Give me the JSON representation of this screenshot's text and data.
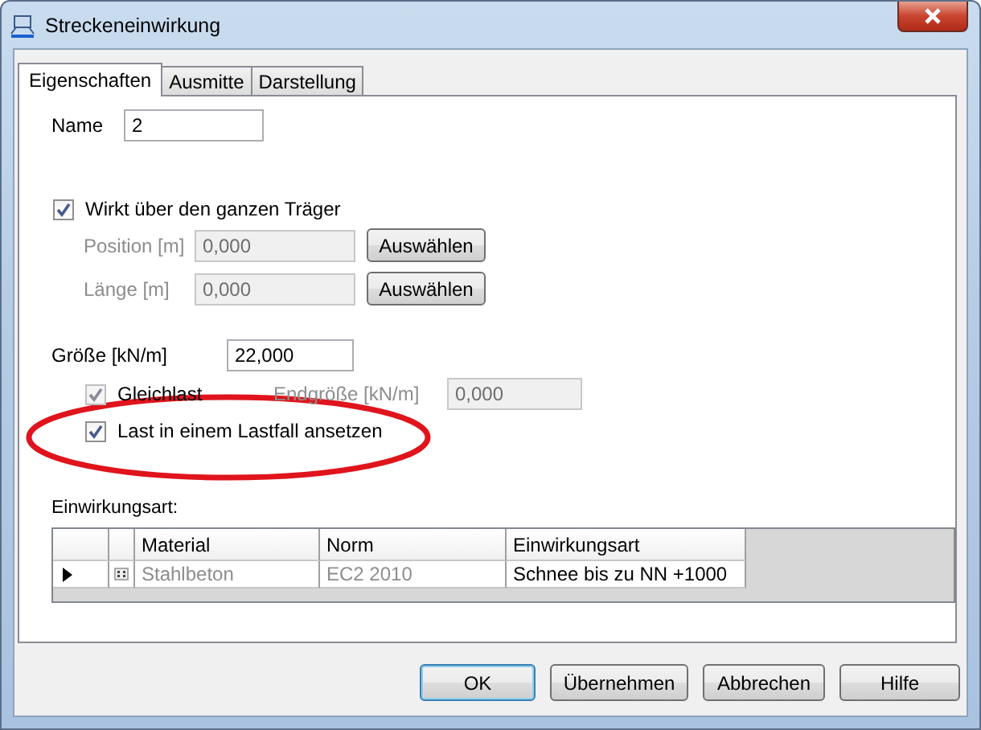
{
  "window": {
    "title": "Streckeneinwirkung"
  },
  "tabs": [
    {
      "label": "Eigenschaften",
      "selected": true
    },
    {
      "label": "Ausmitte",
      "selected": false
    },
    {
      "label": "Darstellung",
      "selected": false
    }
  ],
  "name": {
    "label": "Name",
    "value": "2"
  },
  "whole_beam": {
    "label": "Wirkt über den ganzen Träger",
    "checked": true
  },
  "ranges": [
    {
      "label": "Position [m]",
      "value": "0,000",
      "button": "Auswählen",
      "disabled": true
    },
    {
      "label": "Länge [m]",
      "value": "0,000",
      "button": "Auswählen",
      "disabled": true
    }
  ],
  "magnitude": {
    "label": "Größe [kN/m]",
    "value": "22,000"
  },
  "uniform": {
    "label": "Gleichlast",
    "checked": true,
    "disabled": true
  },
  "end_magnitude": {
    "label": "Endgröße [kN/m]",
    "value": "0,000",
    "disabled": true
  },
  "single_case": {
    "label": "Last in einem Lastfall ansetzen",
    "checked": true
  },
  "action_type": {
    "label": "Einwirkungsart:",
    "columns": [
      "Material",
      "Norm",
      "Einwirkungsart"
    ],
    "rows": [
      {
        "selected": true,
        "cells": [
          {
            "text": "Stahlbeton",
            "disabled": true
          },
          {
            "text": "EC2 2010",
            "disabled": true
          },
          {
            "text": "Schnee bis zu NN +1000",
            "disabled": false
          }
        ]
      }
    ]
  },
  "buttons": [
    {
      "label": "OK",
      "default": true
    },
    {
      "label": "Übernehmen",
      "default": false
    },
    {
      "label": "Abbrechen",
      "default": false
    },
    {
      "label": "Hilfe",
      "default": false
    }
  ]
}
